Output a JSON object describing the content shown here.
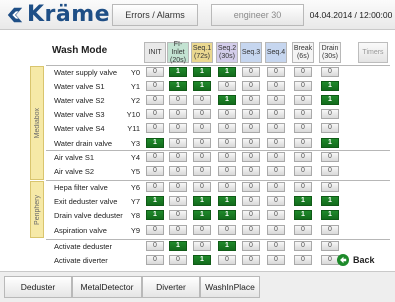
{
  "header": {
    "brand": "Krämer",
    "nav_label": "Errors / Alarms",
    "user_label": "engineer 30",
    "datetime": "04.04.2014 / 12:00:00"
  },
  "panel": {
    "title": "Wash Mode",
    "columns": [
      {
        "line1": "INIT",
        "line2": "",
        "color": "#e9e9e9"
      },
      {
        "line1": "FI-Inlet",
        "line2": "(20s)",
        "color": "#c3e3d2"
      },
      {
        "line1": "Seq.1",
        "line2": "(72s)",
        "color": "#ead890"
      },
      {
        "line1": "Seq.2",
        "line2": "(30s)",
        "color": "#d3cdea"
      },
      {
        "line1": "Seq.3",
        "line2": "",
        "color": "#c6d6ef"
      },
      {
        "line1": "Seq.4",
        "line2": "",
        "color": "#c6d6ef"
      },
      {
        "line1": "Break",
        "line2": "(6s)",
        "color": "#f4f4f4"
      },
      {
        "line1": "Drain",
        "line2": "(30s)",
        "color": "#f4f4f4"
      }
    ],
    "timers_label": "Timers",
    "groups": {
      "mediabox": "Mediabox",
      "periphery": "Periphery"
    },
    "rows": [
      {
        "label": "Water supply valve",
        "code": "Y0",
        "values": [
          0,
          1,
          1,
          1,
          0,
          0,
          0,
          0
        ]
      },
      {
        "label": "Water valve S1",
        "code": "Y1",
        "values": [
          0,
          1,
          1,
          0,
          0,
          0,
          0,
          1
        ]
      },
      {
        "label": "Water valve S2",
        "code": "Y2",
        "values": [
          0,
          0,
          0,
          1,
          0,
          0,
          0,
          1
        ]
      },
      {
        "label": "Water valve S3",
        "code": "Y10",
        "values": [
          0,
          0,
          0,
          0,
          0,
          0,
          0,
          0
        ]
      },
      {
        "label": "Water valve S4",
        "code": "Y11",
        "values": [
          0,
          0,
          0,
          0,
          0,
          0,
          0,
          0
        ]
      },
      {
        "label": "Water drain valve",
        "code": "Y3",
        "values": [
          1,
          0,
          0,
          0,
          0,
          0,
          0,
          1
        ]
      },
      {
        "label": "Air valve S1",
        "code": "Y4",
        "values": [
          0,
          0,
          0,
          0,
          0,
          0,
          0,
          0
        ]
      },
      {
        "label": "Air valve S2",
        "code": "Y5",
        "values": [
          0,
          0,
          0,
          0,
          0,
          0,
          0,
          0
        ]
      },
      {
        "label": "Hepa filter valve",
        "code": "Y6",
        "values": [
          0,
          0,
          0,
          0,
          0,
          0,
          0,
          0
        ]
      },
      {
        "label": "Exit deduster valve",
        "code": "Y7",
        "values": [
          1,
          0,
          1,
          1,
          0,
          0,
          1,
          1
        ]
      },
      {
        "label": "Drain valve deduster",
        "code": "Y8",
        "values": [
          1,
          0,
          1,
          1,
          0,
          0,
          1,
          1
        ]
      },
      {
        "label": "Aspiration valve",
        "code": "Y9",
        "values": [
          0,
          0,
          0,
          0,
          0,
          0,
          0,
          0
        ]
      },
      {
        "label": "Activate deduster",
        "code": "",
        "values": [
          0,
          1,
          0,
          1,
          0,
          0,
          0,
          0
        ]
      },
      {
        "label": "Activate diverter",
        "code": "",
        "values": [
          0,
          0,
          1,
          0,
          0,
          0,
          0,
          0
        ]
      }
    ],
    "back_label": "Back"
  },
  "footer": {
    "tabs": [
      "Deduster",
      "MetalDetector",
      "Diverter",
      "WashInPlace"
    ]
  },
  "colors": {
    "brand": "#1f4f86",
    "on": "#1a7f24",
    "side": "#f6e9a7"
  }
}
